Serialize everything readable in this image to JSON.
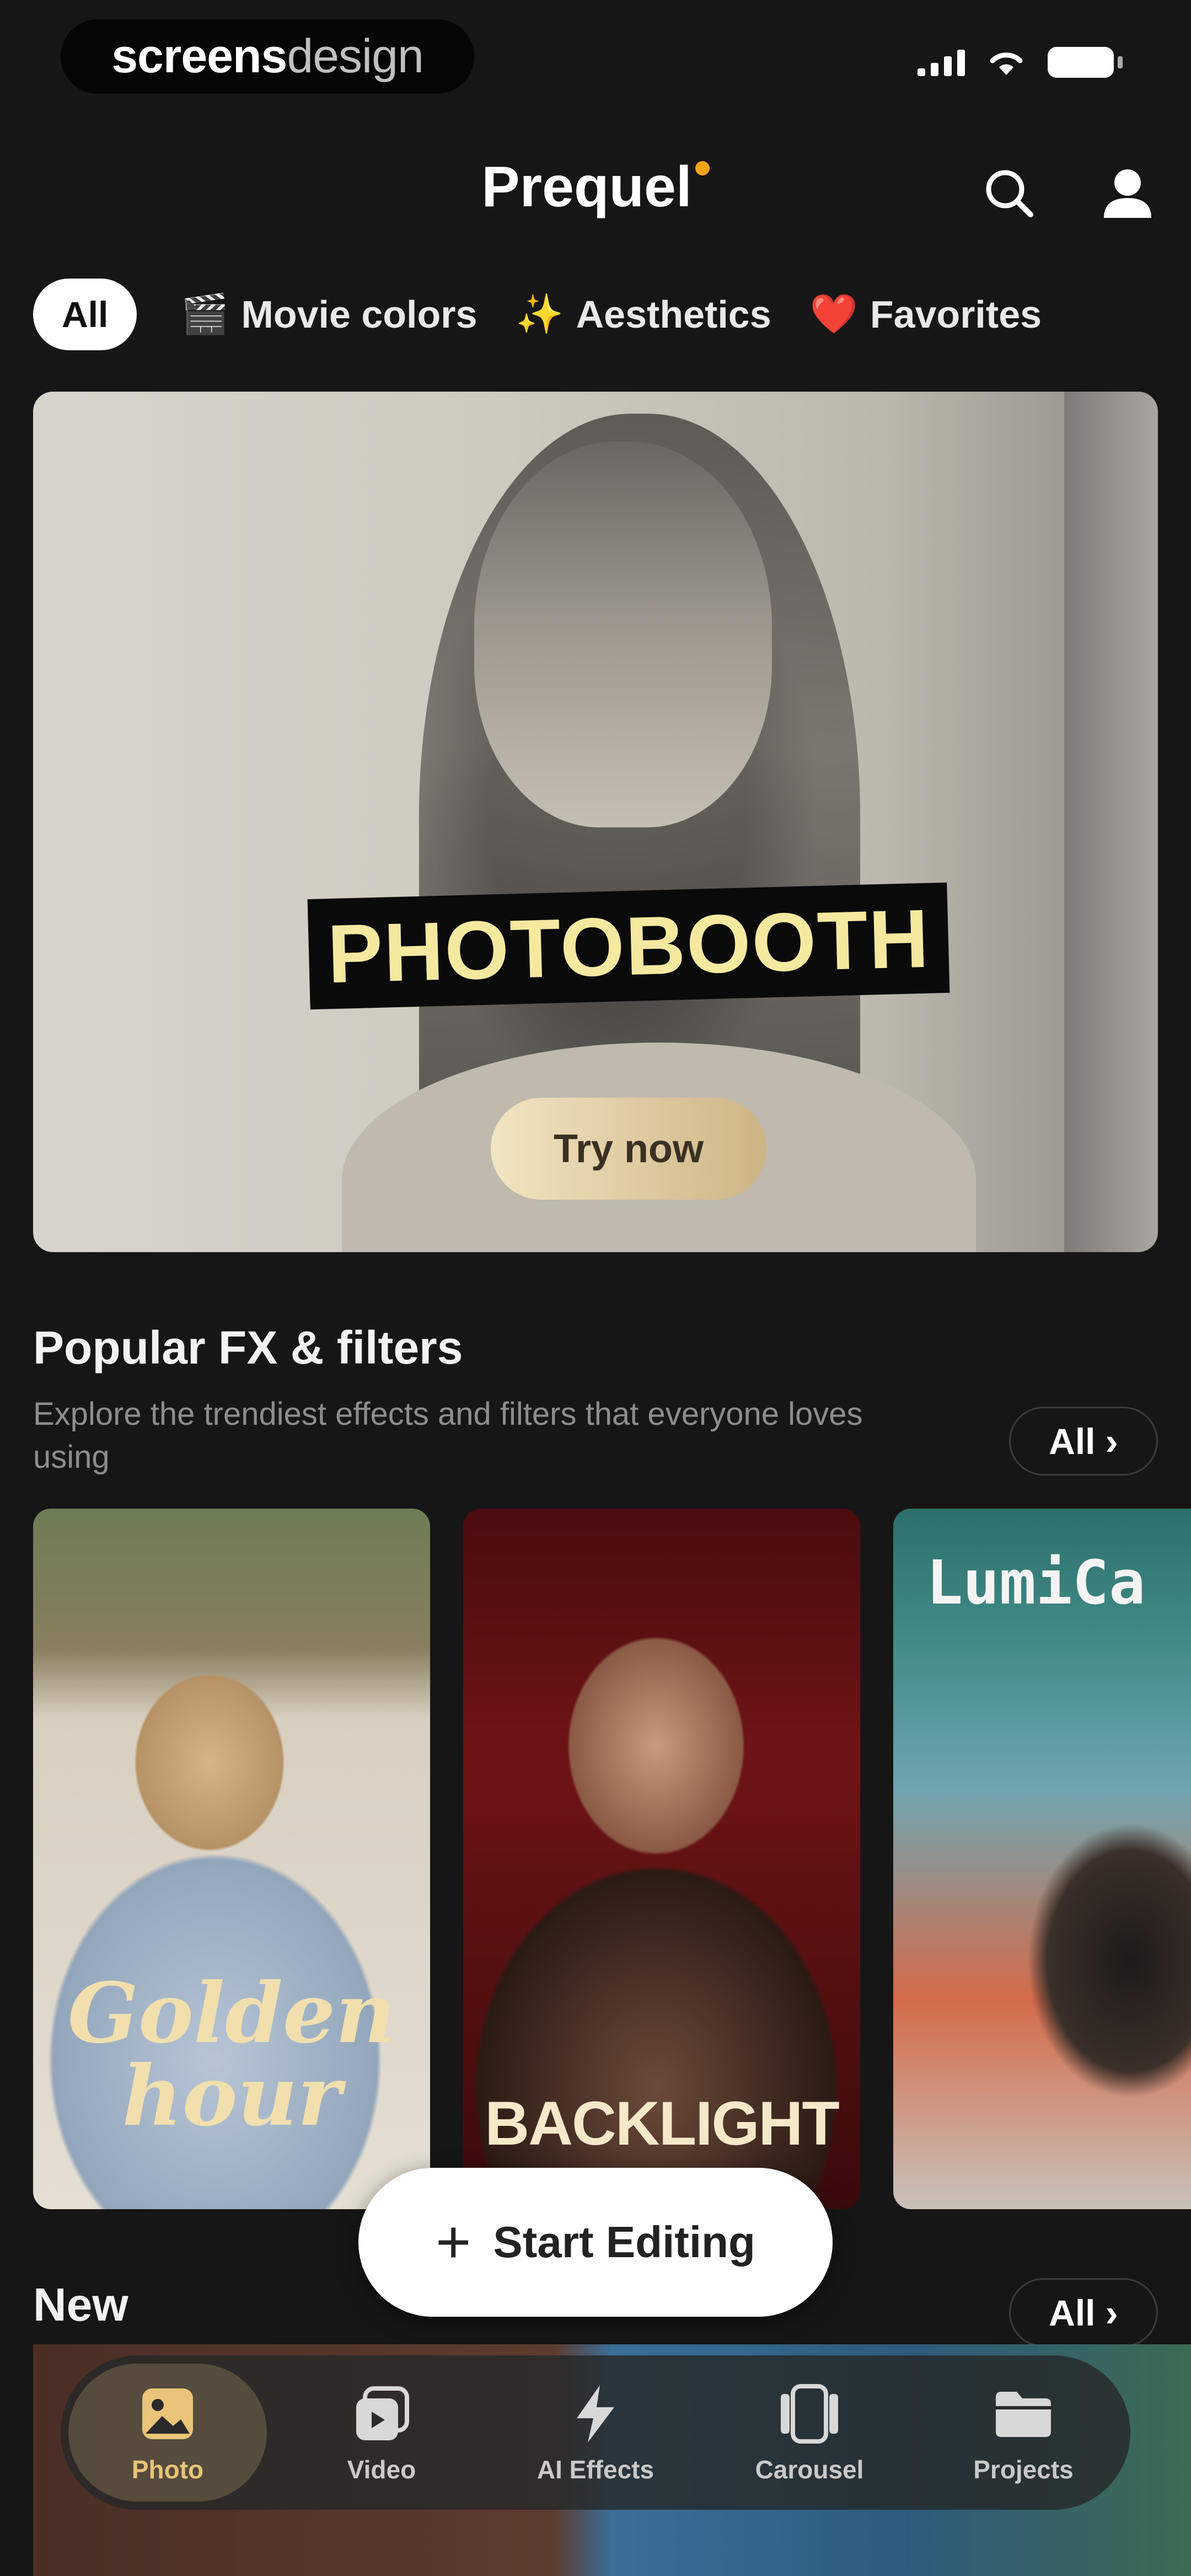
{
  "status_bar": {
    "brand_bold": "screens",
    "brand_light": "design"
  },
  "header": {
    "title": "Prequel"
  },
  "chips": [
    {
      "label": "All",
      "emoji": ""
    },
    {
      "label": "Movie colors",
      "emoji": "🎬"
    },
    {
      "label": "Aesthetics",
      "emoji": "✨"
    },
    {
      "label": "Favorites",
      "emoji": "❤️"
    }
  ],
  "hero": {
    "title": "PHOTOBOOTH",
    "button": "Try now"
  },
  "popular": {
    "title": "Popular FX & filters",
    "subtitle": "Explore the trendiest effects and filters that everyone loves using",
    "all_label": "All",
    "cards": [
      {
        "title": "Golden hour"
      },
      {
        "title": "BACKLIGHT"
      },
      {
        "title": "LumiCa"
      }
    ]
  },
  "fab": {
    "label": "Start Editing"
  },
  "new_section": {
    "title": "New",
    "all_label": "All"
  },
  "tabbar": [
    {
      "label": "Photo",
      "icon": "photo-icon"
    },
    {
      "label": "Video",
      "icon": "video-icon"
    },
    {
      "label": "AI Effects",
      "icon": "lightning-icon"
    },
    {
      "label": "Carousel",
      "icon": "carousel-icon"
    },
    {
      "label": "Projects",
      "icon": "folder-icon"
    }
  ],
  "colors": {
    "background": "#161616",
    "accent": "#f3a21c",
    "tab_active": "#e9c479"
  }
}
